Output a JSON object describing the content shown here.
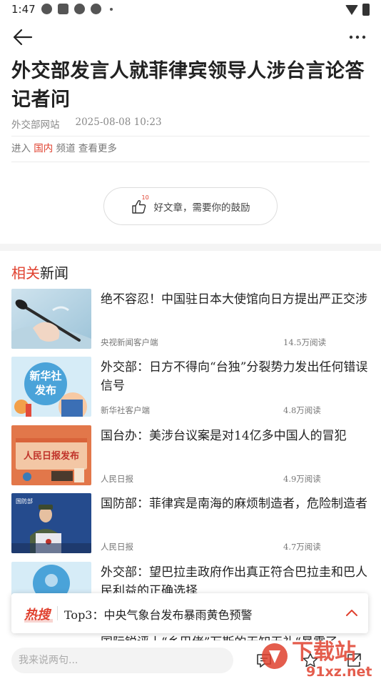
{
  "status_bar": {
    "time": "1:47"
  },
  "article": {
    "title": "外交部发言人就菲律宾领导人涉台言论答记者问",
    "source": "外交部网站",
    "datetime": "2025-08-08 10:23",
    "channel_prefix": "进入",
    "channel_name": "国内",
    "channel_suffix": "频道 查看更多"
  },
  "encourage": {
    "like_count": "10",
    "label": "好文章，需要你的鼓励"
  },
  "related": {
    "title_red": "相关",
    "title_rest": "新闻",
    "items": [
      {
        "title": "绝不容忍！中国驻日本大使馆向日方提出严正交涉",
        "source": "央视新闻客户端",
        "reads": "14.5万阅读",
        "thumb": "microphone-photo"
      },
      {
        "title": "外交部：日方不得向“台独”分裂势力发出任何错误信号",
        "source": "新华社客户端",
        "reads": "4.8万阅读",
        "thumb": "xinhua-release-graphic",
        "thumb_text": "新华社发布"
      },
      {
        "title": "国台办：美涉台议案是对14亿多中国人的冒犯",
        "source": "人民日报",
        "reads": "4.9万阅读",
        "thumb": "peoples-daily-release-graphic",
        "thumb_text": "人民日报发布"
      },
      {
        "title": "国防部：菲律宾是南海的麻烦制造者，危险制造者",
        "source": "人民日报",
        "reads": "4.7万阅读",
        "thumb": "ministry-of-defense-photo",
        "thumb_text": "国防部"
      },
      {
        "title": "外交部：望巴拉圭政府作出真正符合巴拉圭和巴人民利益的正确选择",
        "thumb": "xinhua-release-graphic-2"
      }
    ],
    "behind_text": "国际锐评丨“乡巴佬”万斯的无知无礼“暴露了"
  },
  "hot_search": {
    "label": "热搜",
    "text": "Top3：中央气象台发布暴雨黄色预警",
    "icon": "chevron-up-icon"
  },
  "bottom_bar": {
    "comment_placeholder": "我来说两句...",
    "icons": [
      "comment-icon",
      "star-icon",
      "share-icon"
    ]
  },
  "watermark": {
    "text": "下载站",
    "url_text": "91xz.net"
  },
  "colors": {
    "accent": "#e0412f",
    "text": "#222222",
    "muted": "#888888",
    "band": "#f4f4f4"
  }
}
